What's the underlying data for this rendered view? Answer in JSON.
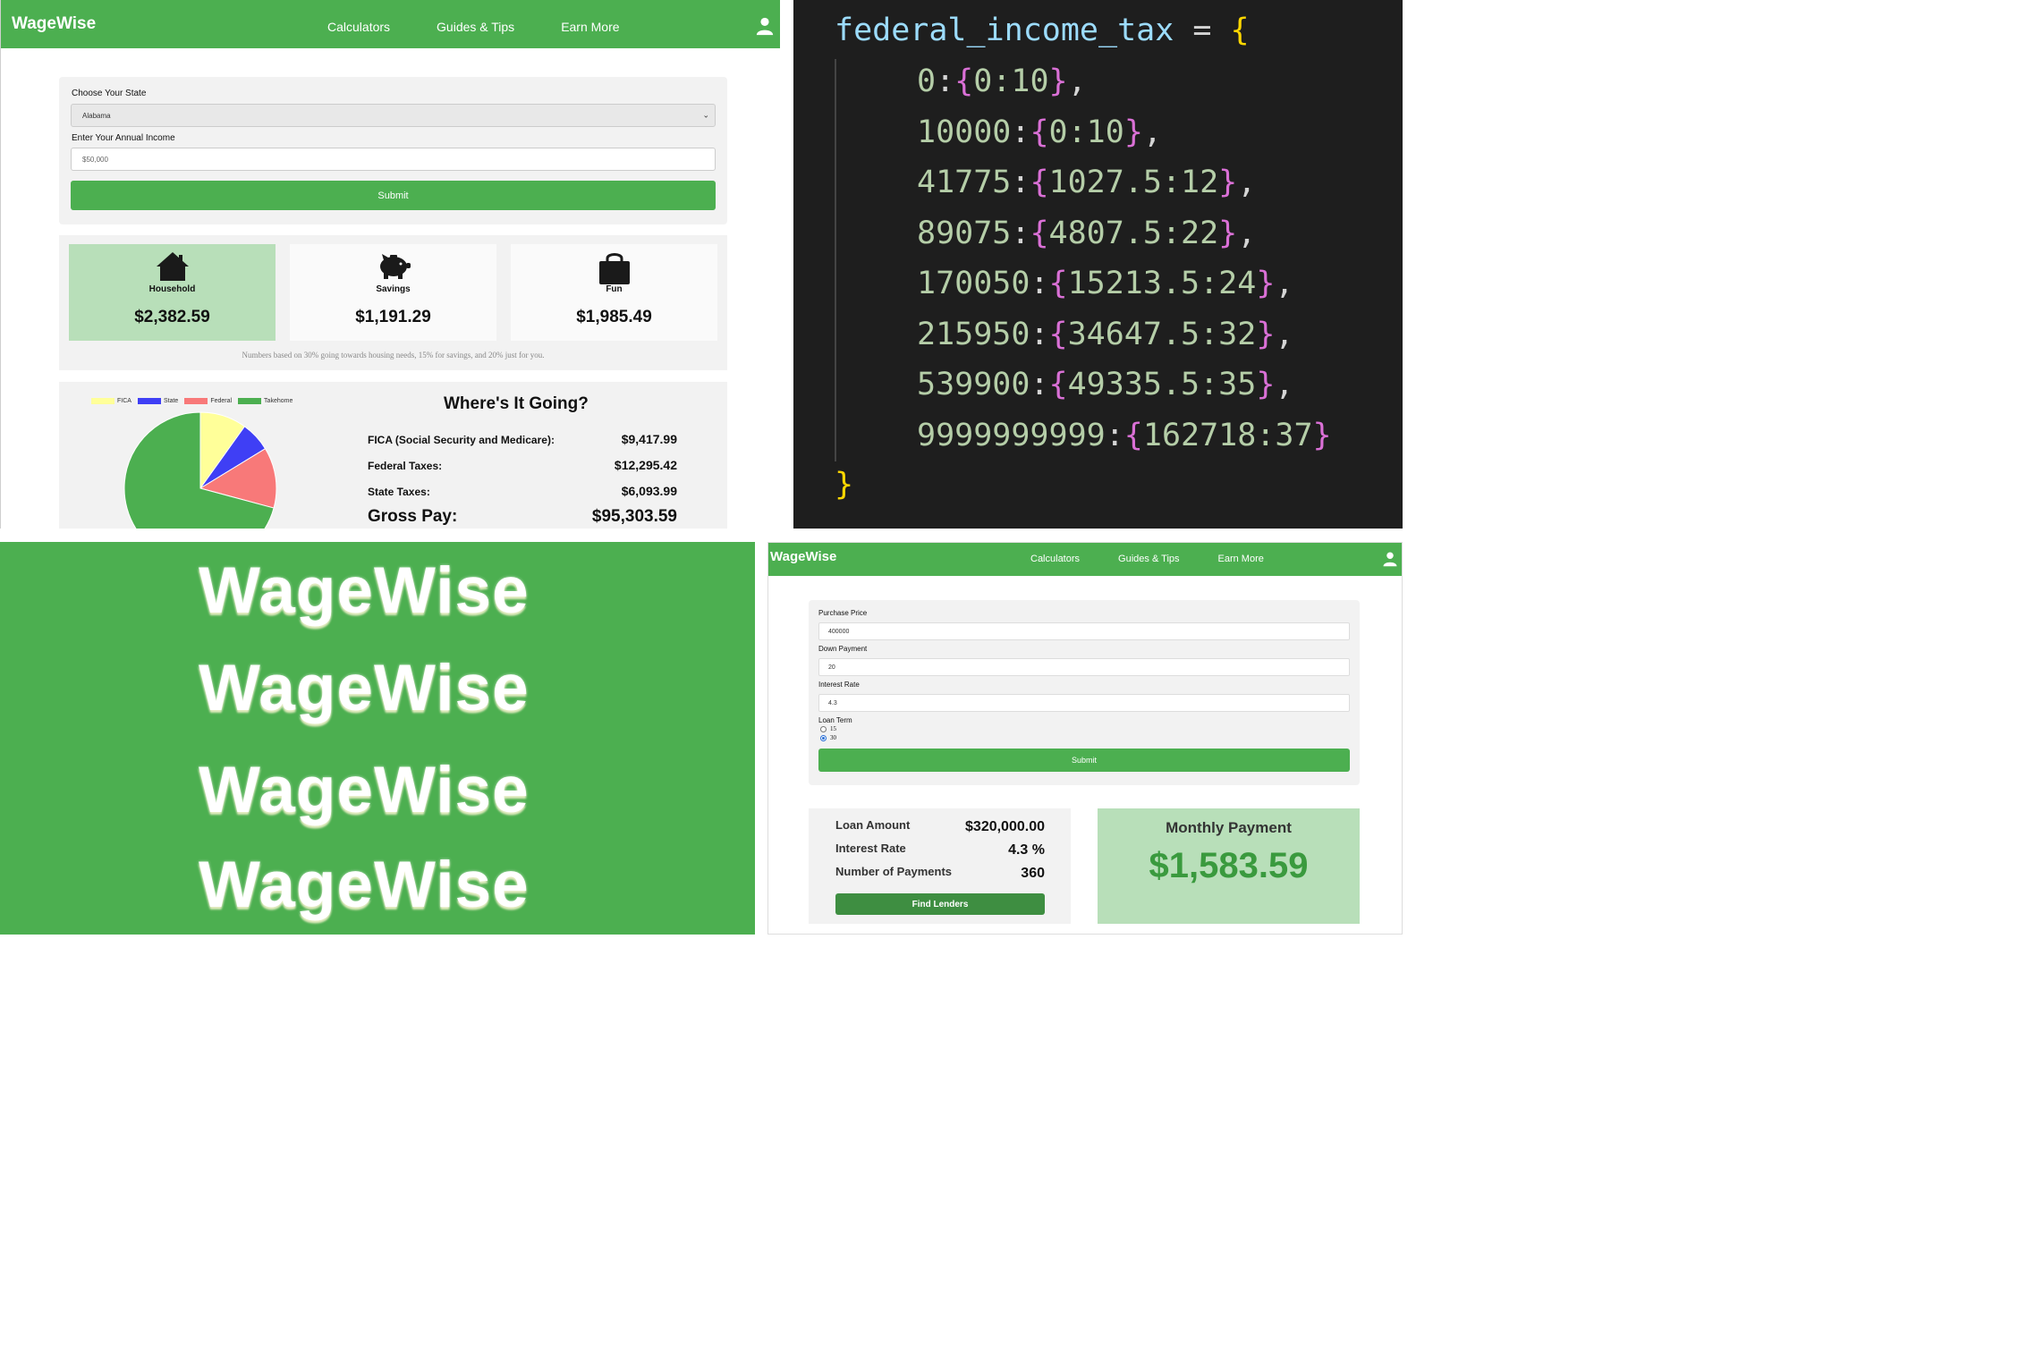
{
  "take_home": {
    "nav": {
      "brand": "WageWise",
      "links": [
        "Calculators",
        "Guides & Tips",
        "Earn More"
      ],
      "user_icon": "user-icon"
    },
    "form": {
      "state_label": "Choose Your State",
      "state_value": "Alabama",
      "income_label": "Enter Your Annual Income",
      "income_placeholder": "$50,000",
      "submit_label": "Submit"
    },
    "budget": {
      "cards": [
        {
          "name": "Household",
          "value": "$2,382.59",
          "icon": "house-icon",
          "active": true
        },
        {
          "name": "Savings",
          "value": "$1,191.29",
          "icon": "piggy-bank-icon",
          "active": false
        },
        {
          "name": "Fun",
          "value": "$1,985.49",
          "icon": "shopping-bag-icon",
          "active": false
        }
      ],
      "note": "Numbers based on 30% going towards housing needs, 15% for savings, and 20% just for you."
    },
    "where_going": {
      "title": "Where's It Going?",
      "rows": [
        {
          "label": "FICA (Social Security and Medicare):",
          "value": "$9,417.99"
        },
        {
          "label": "Federal Taxes:",
          "value": "$12,295.42"
        },
        {
          "label": "State Taxes:",
          "value": "$6,093.99"
        }
      ],
      "gross_label": "Gross Pay:",
      "gross_value": "$95,303.59"
    },
    "chart_data": {
      "type": "pie",
      "legend": [
        "FICA",
        "State",
        "Federal",
        "Takehome"
      ],
      "colors": [
        "#ffff99",
        "#3f3ff5",
        "#f87979",
        "#4caf50"
      ],
      "values": [
        9417.99,
        6093.99,
        12295.42,
        67496.19
      ]
    }
  },
  "code": {
    "var_name": "federal_income_tax",
    "assign": " = ",
    "open_brace": "{",
    "close_brace": "}",
    "entries": [
      {
        "key": "0",
        "inner": "0:10",
        "comma": ","
      },
      {
        "key": "10000",
        "inner": "0:10",
        "comma": ","
      },
      {
        "key": "41775",
        "inner": "1027.5:12",
        "comma": ","
      },
      {
        "key": "89075",
        "inner": "4807.5:22",
        "comma": ","
      },
      {
        "key": "170050",
        "inner": "15213.5:24",
        "comma": ","
      },
      {
        "key": "215950",
        "inner": "34647.5:32",
        "comma": ","
      },
      {
        "key": "539900",
        "inner": "49335.5:35",
        "comma": ","
      },
      {
        "key": "9999999999",
        "inner": "162718:37",
        "comma": ""
      }
    ]
  },
  "logos": [
    "WageWise",
    "WageWise",
    "WageWise",
    "WageWise"
  ],
  "mortgage": {
    "nav": {
      "brand": "WageWise",
      "links": [
        "Calculators",
        "Guides & Tips",
        "Earn More"
      ]
    },
    "form": {
      "purchase_label": "Purchase Price",
      "purchase_value": "400000",
      "down_label": "Down Payment",
      "down_value": "20",
      "rate_label": "Interest Rate",
      "rate_value": "4.3",
      "term_label": "Loan Term",
      "term_options": [
        {
          "label": "15",
          "checked": false
        },
        {
          "label": "30",
          "checked": true
        }
      ],
      "submit_label": "Submit"
    },
    "summary": {
      "rows": [
        {
          "label": "Loan Amount",
          "value": "$320,000.00"
        },
        {
          "label": "Interest Rate",
          "value": "4.3 %"
        },
        {
          "label": "Number of Payments",
          "value": "360"
        }
      ],
      "button_label": "Find Lenders"
    },
    "monthly": {
      "title": "Monthly Payment",
      "value": "$1,583.59"
    }
  }
}
